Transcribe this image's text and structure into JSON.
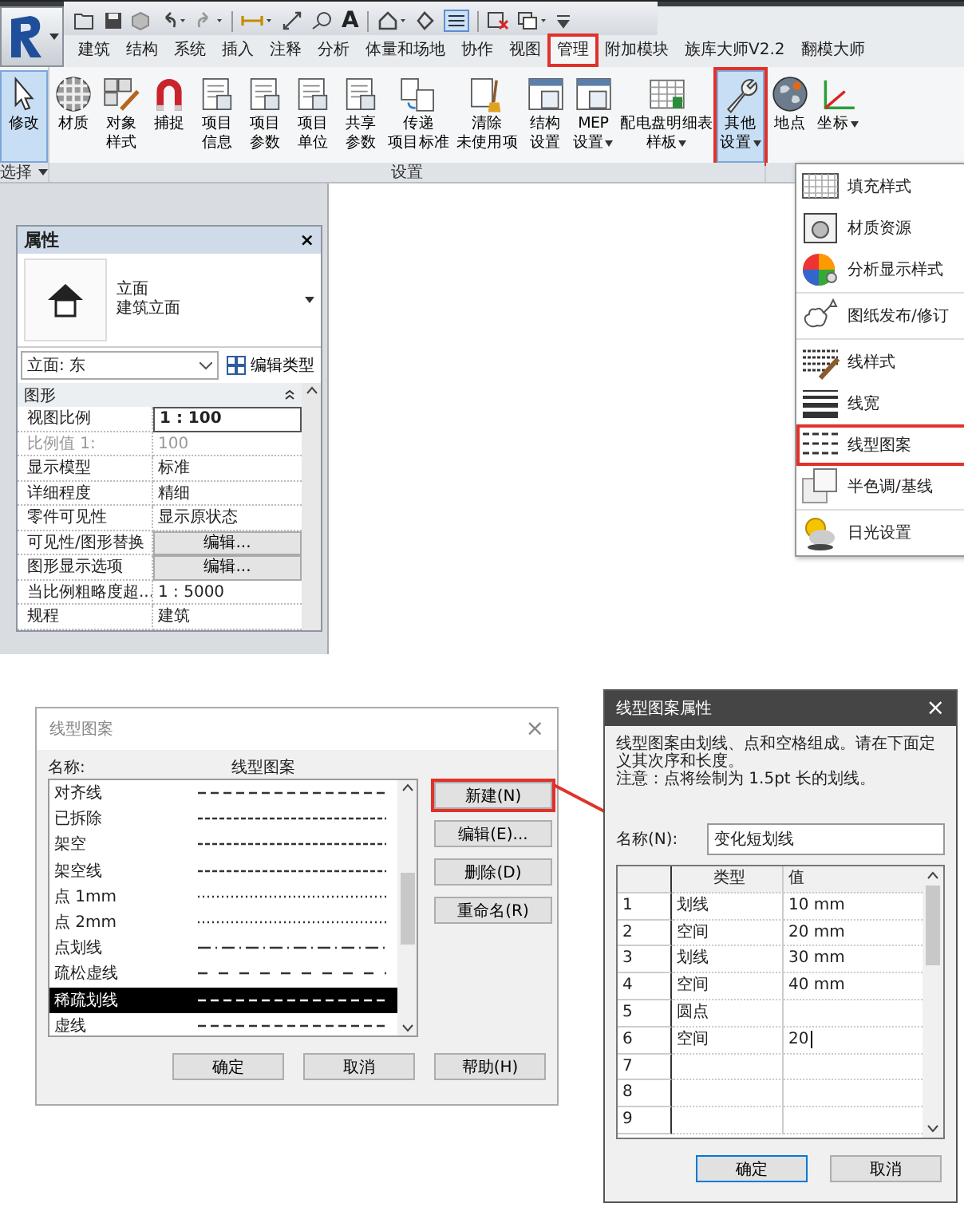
{
  "quick_access": {
    "text_tool": "A"
  },
  "tabs": [
    {
      "label": "建筑",
      "selected": false,
      "highlighted": false
    },
    {
      "label": "结构",
      "selected": false,
      "highlighted": false
    },
    {
      "label": "系统",
      "selected": false,
      "highlighted": false
    },
    {
      "label": "插入",
      "selected": false,
      "highlighted": false
    },
    {
      "label": "注释",
      "selected": false,
      "highlighted": false
    },
    {
      "label": "分析",
      "selected": false,
      "highlighted": false
    },
    {
      "label": "体量和场地",
      "selected": false,
      "highlighted": false
    },
    {
      "label": "协作",
      "selected": false,
      "highlighted": false
    },
    {
      "label": "视图",
      "selected": false,
      "highlighted": false
    },
    {
      "label": "管理",
      "selected": true,
      "highlighted": true
    },
    {
      "label": "附加模块",
      "selected": false,
      "highlighted": false
    },
    {
      "label": "族库大师V2.2",
      "selected": false,
      "highlighted": false
    },
    {
      "label": "翻模大师",
      "selected": false,
      "highlighted": false
    }
  ],
  "ribbon": {
    "panels": [
      {
        "label": "选择",
        "has_menu": true,
        "buttons": [
          {
            "lines": [
              "修改"
            ],
            "selected": true,
            "dropdown": false,
            "highlighted": false
          }
        ]
      },
      {
        "label": "设置",
        "has_menu": false,
        "buttons": [
          {
            "lines": [
              "材质"
            ],
            "selected": false,
            "dropdown": false,
            "highlighted": false
          },
          {
            "lines": [
              "对象",
              "样式"
            ],
            "selected": false,
            "dropdown": false,
            "highlighted": false
          },
          {
            "lines": [
              "捕捉"
            ],
            "selected": false,
            "dropdown": false,
            "highlighted": false
          },
          {
            "lines": [
              "项目",
              "信息"
            ],
            "selected": false,
            "dropdown": false,
            "highlighted": false
          },
          {
            "lines": [
              "项目",
              "参数"
            ],
            "selected": false,
            "dropdown": false,
            "highlighted": false
          },
          {
            "lines": [
              "项目",
              "单位"
            ],
            "selected": false,
            "dropdown": false,
            "highlighted": false
          },
          {
            "lines": [
              "共享",
              "参数"
            ],
            "selected": false,
            "dropdown": false,
            "highlighted": false
          },
          {
            "lines": [
              "传递",
              "项目标准"
            ],
            "selected": false,
            "dropdown": false,
            "highlighted": false
          },
          {
            "lines": [
              "清除",
              "未使用项"
            ],
            "selected": false,
            "dropdown": false,
            "highlighted": false
          },
          {
            "lines": [
              "结构",
              "设置"
            ],
            "selected": false,
            "dropdown": false,
            "highlighted": false
          },
          {
            "lines": [
              "MEP",
              "设置"
            ],
            "selected": false,
            "dropdown": true,
            "highlighted": false
          },
          {
            "lines": [
              "配电盘明细表",
              "样板"
            ],
            "selected": false,
            "dropdown": true,
            "highlighted": false
          },
          {
            "lines": [
              "其他",
              "设置"
            ],
            "selected": true,
            "dropdown": true,
            "highlighted": true
          }
        ]
      },
      {
        "has_menu": false,
        "buttons": [
          {
            "lines": [
              "地点"
            ],
            "selected": false,
            "dropdown": false,
            "highlighted": false
          },
          {
            "lines": [
              "坐标"
            ],
            "selected": false,
            "dropdown": true,
            "highlighted": false
          }
        ]
      }
    ]
  },
  "properties": {
    "title": "属性",
    "close": "×",
    "type_name": "立面",
    "type_family": "建筑立面",
    "instance": "立面: 东",
    "edit_type": "编辑类型",
    "group": "图形",
    "rows": [
      {
        "label": "视图比例",
        "value": "1 : 100",
        "kind": "field"
      },
      {
        "label": "比例值 1:",
        "value": "100",
        "kind": "disabled"
      },
      {
        "label": "显示模型",
        "value": "标准",
        "kind": "text"
      },
      {
        "label": "详细程度",
        "value": "精细",
        "kind": "text"
      },
      {
        "label": "零件可见性",
        "value": "显示原状态",
        "kind": "text"
      },
      {
        "label": "可见性/图形替换",
        "value": "编辑...",
        "kind": "button"
      },
      {
        "label": "图形显示选项",
        "value": "编辑...",
        "kind": "button"
      },
      {
        "label": "当比例粗略度超...",
        "value": "1 : 5000",
        "kind": "text"
      },
      {
        "label": "规程",
        "value": "建筑",
        "kind": "text"
      }
    ]
  },
  "other_settings_menu": {
    "groups": [
      [
        {
          "label": "填充样式",
          "highlighted": false
        },
        {
          "label": "材质资源",
          "highlighted": false
        },
        {
          "label": "分析显示样式",
          "highlighted": false
        }
      ],
      [
        {
          "label": "图纸发布/修订",
          "highlighted": false
        }
      ],
      [
        {
          "label": "线样式",
          "highlighted": false
        },
        {
          "label": "线宽",
          "highlighted": false
        },
        {
          "label": "线型图案",
          "highlighted": true
        },
        {
          "label": "半色调/基线",
          "highlighted": false
        }
      ],
      [
        {
          "label": "日光设置",
          "highlighted": false
        }
      ]
    ]
  },
  "line_patterns_dialog": {
    "title": "线型图案",
    "close": "×",
    "columns": [
      "名称:",
      "线型图案"
    ],
    "rows": [
      {
        "name": "对齐线",
        "kind": "dash",
        "selected": false
      },
      {
        "name": "已拆除",
        "kind": "fine-dash",
        "selected": false
      },
      {
        "name": "架空",
        "kind": "fine-dash",
        "selected": false
      },
      {
        "name": "架空线",
        "kind": "fine-dash",
        "selected": false
      },
      {
        "name": "点 1mm",
        "kind": "dot",
        "selected": false
      },
      {
        "name": "点 2mm",
        "kind": "dot",
        "selected": false
      },
      {
        "name": "点划线",
        "kind": "dash-dot",
        "selected": false
      },
      {
        "name": "疏松虚线",
        "kind": "sparse-dash",
        "selected": false
      },
      {
        "name": "稀疏划线",
        "kind": "dash",
        "selected": true
      },
      {
        "name": "虚线",
        "kind": "dash",
        "selected": false
      }
    ],
    "side_buttons": [
      {
        "label": "新建(N)",
        "highlighted": true
      },
      {
        "label": "编辑(E)...",
        "highlighted": false
      },
      {
        "label": "删除(D)",
        "highlighted": false
      },
      {
        "label": "重命名(R)",
        "highlighted": false
      }
    ],
    "buttons": [
      "确定",
      "取消",
      "帮助(H)"
    ]
  },
  "pattern_properties_dialog": {
    "title": "线型图案属性",
    "close": "×",
    "description": "线型图案由划线、点和空格组成。请在下面定义其次序和长度。",
    "note": "注意：点将绘制为 1.5pt 长的划线。",
    "name_label": "名称(N):",
    "name_value": "变化短划线",
    "columns": [
      "类型",
      "值"
    ],
    "rows": [
      {
        "index": "1",
        "type": "划线",
        "value": "10 mm"
      },
      {
        "index": "2",
        "type": "空间",
        "value": "20 mm"
      },
      {
        "index": "3",
        "type": "划线",
        "value": "30 mm"
      },
      {
        "index": "4",
        "type": "空间",
        "value": "40 mm"
      },
      {
        "index": "5",
        "type": "圆点"
      },
      {
        "index": "6",
        "type": "空间",
        "value": "20",
        "editing": true
      },
      {
        "index": "7"
      },
      {
        "index": "8"
      },
      {
        "index": "9"
      }
    ],
    "buttons": [
      "确定",
      "取消"
    ]
  }
}
